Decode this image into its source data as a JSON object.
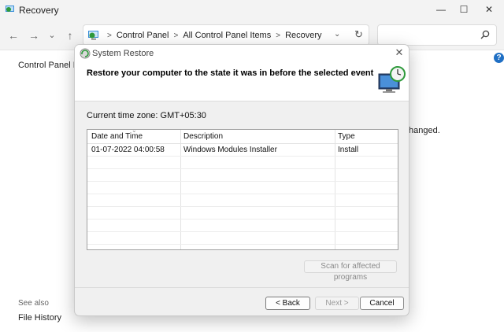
{
  "background_window": {
    "title": "Recovery",
    "controls": {
      "minimize": "—",
      "maximize": "☐",
      "close": "✕"
    },
    "nav": {
      "back": "←",
      "forward": "→",
      "recent": "⌄",
      "up": "↑"
    },
    "breadcrumbs": [
      "Control Panel",
      "All Control Panel Items",
      "Recovery"
    ],
    "breadcrumb_sep": ">",
    "address_dropdown": "⌄",
    "refresh": "↻",
    "sidebar_link": "Control Panel Ho",
    "body_text_fragment": "hanged.",
    "see_also": "See also",
    "file_history": "File History",
    "help": "?"
  },
  "dialog": {
    "title": "System Restore",
    "close": "✕",
    "heading": "Restore your computer to the state it was in before the selected event",
    "timezone_label": "Current time zone: GMT+05:30",
    "table": {
      "columns": [
        "Date and Time",
        "Description",
        "Type"
      ],
      "sort_caret": "⌄",
      "rows": [
        {
          "date": "01-07-2022 04:00:58",
          "description": "Windows Modules Installer",
          "type": "Install"
        }
      ]
    },
    "scan_button": "Scan for affected programs",
    "back_button": "< Back",
    "next_button": "Next >",
    "cancel_button": "Cancel"
  },
  "colors": {
    "accent": "#1f6fc4",
    "dialog_bg": "#f0f0f0",
    "titlebar_bg": "#f3f3f3"
  },
  "icons": [
    "control-panel-icon",
    "search-icon",
    "system-restore-icon",
    "monitor-clock-icon",
    "help-icon"
  ]
}
